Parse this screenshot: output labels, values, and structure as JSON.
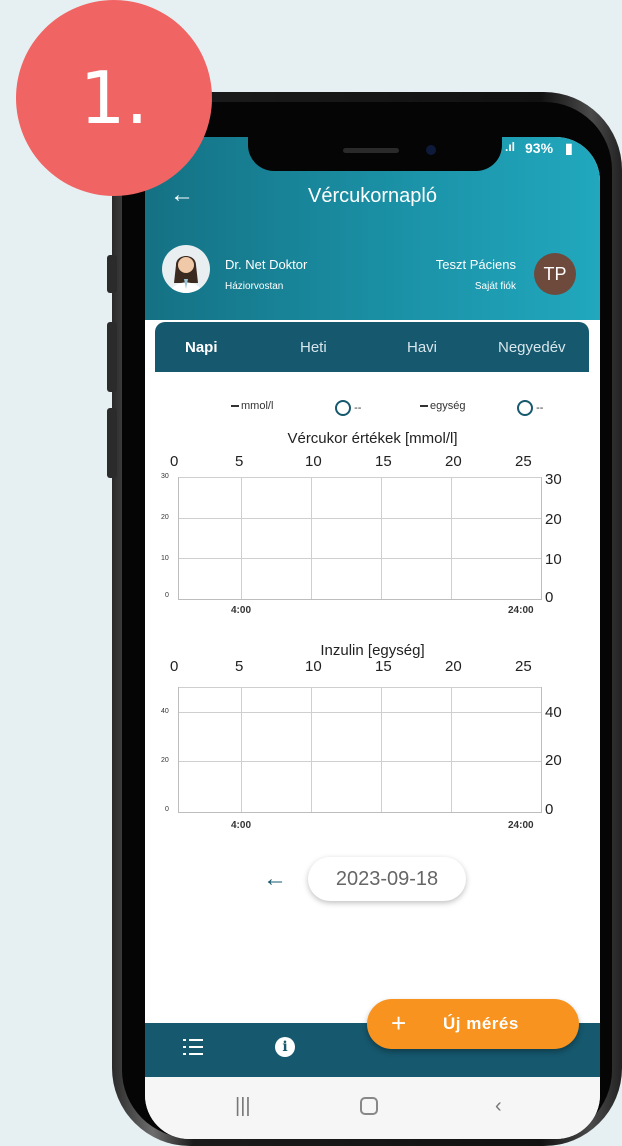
{
  "step_badge": "1.",
  "status_bar": {
    "battery": "93%",
    "signal": "LTE"
  },
  "header": {
    "back_icon": "arrow-left-icon",
    "title": "Vércukornapló"
  },
  "doctor": {
    "name": "Dr. Net Doktor",
    "role": "Háziorvostan"
  },
  "patient": {
    "name": "Teszt Páciens",
    "account": "Saját fiók",
    "initials": "TP"
  },
  "tabs": [
    {
      "label": "Napi",
      "active": true
    },
    {
      "label": "Heti",
      "active": false
    },
    {
      "label": "Havi",
      "active": false
    },
    {
      "label": "Negyedév",
      "active": false
    }
  ],
  "legend": {
    "glucose_value": "mmol/l",
    "glucose_time": "--",
    "insulin_value": "egység",
    "insulin_time": "--"
  },
  "glucose_chart": {
    "title": "Vércukor értékek [mmol/l]",
    "top_ticks": [
      "0",
      "5",
      "10",
      "15",
      "20",
      "25"
    ],
    "right_ticks": [
      "30",
      "20",
      "10",
      "0"
    ],
    "left_ticks": [
      "30",
      "20",
      "10",
      "0"
    ],
    "bottom_ticks": [
      "4:00",
      "24:00"
    ]
  },
  "insulin_chart": {
    "title": "Inzulin [egység]",
    "top_ticks": [
      "0",
      "5",
      "10",
      "15",
      "20",
      "25"
    ],
    "right_ticks": [
      "40",
      "20",
      "0"
    ],
    "left_ticks": [
      "40",
      "20",
      "0"
    ],
    "bottom_ticks": [
      "4:00",
      "24:00"
    ]
  },
  "date_nav": {
    "prev_icon": "arrow-left-icon",
    "date": "2023-09-18"
  },
  "fab": {
    "icon": "plus-icon",
    "label": "Új mérés"
  },
  "bottom_nav": {
    "list_icon": "list-icon",
    "info_icon": "info-icon"
  },
  "colors": {
    "primary": "#16586e",
    "header_gradient_end": "#21a8be",
    "accent": "#f7931e",
    "badge": "#f06464"
  }
}
